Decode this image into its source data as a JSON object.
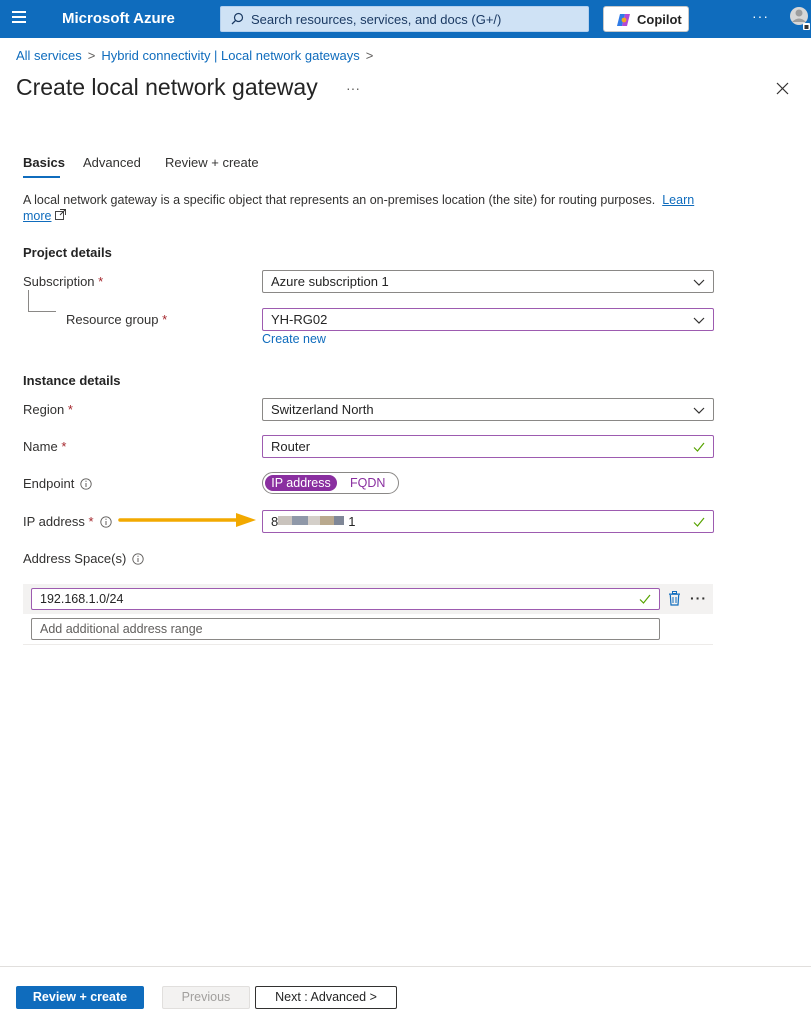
{
  "topbar": {
    "brand": "Microsoft Azure",
    "search_placeholder": "Search resources, services, and docs (G+/)",
    "copilot_label": "Copilot",
    "more_label": "···"
  },
  "breadcrumb": {
    "items": [
      "All services",
      "Hybrid connectivity | Local network gateways"
    ],
    "separator": ">"
  },
  "page": {
    "title": "Create local network gateway",
    "more_label": "···"
  },
  "tabs": [
    {
      "label": "Basics",
      "active": true
    },
    {
      "label": "Advanced",
      "active": false
    },
    {
      "label": "Review + create",
      "active": false
    }
  ],
  "intro": {
    "text": "A local network gateway is a specific object that represents an on-premises location (the site) for routing purposes.",
    "link_word1": "Learn",
    "link_word2": "more"
  },
  "project_details": {
    "heading": "Project details",
    "subscription_label": "Subscription",
    "subscription_value": "Azure subscription 1",
    "resource_group_label": "Resource group",
    "resource_group_value": "YH-RG02",
    "create_new_label": "Create new"
  },
  "instance_details": {
    "heading": "Instance details",
    "region_label": "Region",
    "region_value": "Switzerland North",
    "name_label": "Name",
    "name_value": "Router",
    "endpoint_label": "Endpoint",
    "endpoint_options": [
      "IP address",
      "FQDN"
    ],
    "endpoint_selected": "IP address",
    "ip_label": "IP address",
    "ip_visible_prefix": "8",
    "ip_visible_suffix": "1",
    "address_spaces_label": "Address Space(s)",
    "address_spaces": [
      "192.168.1.0/24"
    ],
    "add_range_placeholder": "Add additional address range"
  },
  "required_marker": "*",
  "footer": {
    "review_create": "Review + create",
    "previous": "Previous",
    "next": "Next : Advanced >"
  },
  "colors": {
    "topbar": "#0f6cbd",
    "link": "#0f6cbd",
    "accent_purple": "#8a2fa0",
    "valid_check": "#57a300",
    "required": "#a4262c",
    "arrow": "#f2a900"
  }
}
